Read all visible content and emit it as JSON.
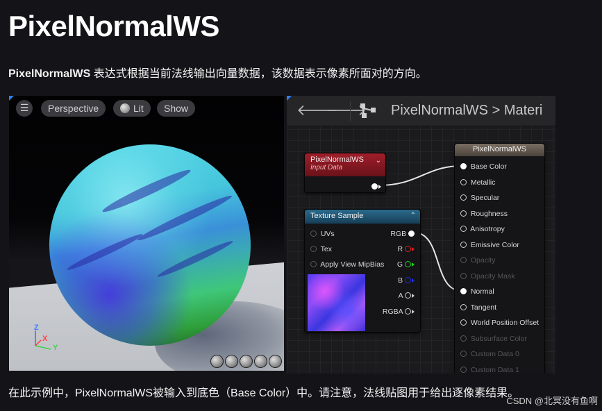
{
  "page": {
    "title": "PixelNormalWS",
    "desc_bold": "PixelNormalWS",
    "desc_rest": " 表达式根据当前法线输出向量数据，该数据表示像素所面对的方向。",
    "caption": "在此示例中，PixelNormalWS被输入到底色（Base Color）中。请注意，法线贴图用于给出逐像素结果。",
    "watermark": "CSDN @北冥没有鱼啊"
  },
  "viewport": {
    "menu_icon": "hamburger-icon",
    "perspective_label": "Perspective",
    "lit_label": "Lit",
    "show_label": "Show",
    "gizmo": {
      "z": "Z",
      "x": "X",
      "y": "Y"
    },
    "preview_icons": [
      "cylinder-preview-icon",
      "sphere-preview-icon",
      "plane-preview-icon",
      "cube-preview-icon",
      "teapot-preview-icon"
    ]
  },
  "graph": {
    "back_icon": "arrow-left-icon",
    "forward_icon": "arrow-right-icon",
    "breadcrumb": "PixelNormalWS  >  Materi",
    "input_node": {
      "title": "PixelNormalWS",
      "subtitle": "Input Data",
      "color": "#8a1a22"
    },
    "texture_node": {
      "title": "Texture Sample",
      "color": "#1f4f6a",
      "inputs": [
        "UVs",
        "Tex",
        "Apply View MipBias"
      ],
      "outputs": [
        {
          "label": "RGB",
          "color": "#ffffff"
        },
        {
          "label": "R",
          "color": "#e02020"
        },
        {
          "label": "G",
          "color": "#20d020"
        },
        {
          "label": "B",
          "color": "#2030e0"
        },
        {
          "label": "A",
          "color": "#cfcfcf"
        },
        {
          "label": "RGBA",
          "color": "#cfcfcf"
        }
      ]
    },
    "material_node": {
      "title": "PixelNormalWS",
      "color": "#5a5048",
      "pins": [
        {
          "label": "Base Color",
          "active": true,
          "connected": true
        },
        {
          "label": "Metallic",
          "active": true,
          "connected": false
        },
        {
          "label": "Specular",
          "active": true,
          "connected": false
        },
        {
          "label": "Roughness",
          "active": true,
          "connected": false
        },
        {
          "label": "Anisotropy",
          "active": true,
          "connected": false
        },
        {
          "label": "Emissive Color",
          "active": true,
          "connected": false
        },
        {
          "label": "Opacity",
          "active": false,
          "connected": false
        },
        {
          "label": "Opacity Mask",
          "active": false,
          "connected": false
        },
        {
          "label": "Normal",
          "active": true,
          "connected": true
        },
        {
          "label": "Tangent",
          "active": true,
          "connected": false
        },
        {
          "label": "World Position Offset",
          "active": true,
          "connected": false
        },
        {
          "label": "Subsurface Color",
          "active": false,
          "connected": false
        },
        {
          "label": "Custom Data 0",
          "active": false,
          "connected": false
        },
        {
          "label": "Custom Data 1",
          "active": false,
          "connected": false
        }
      ]
    }
  }
}
